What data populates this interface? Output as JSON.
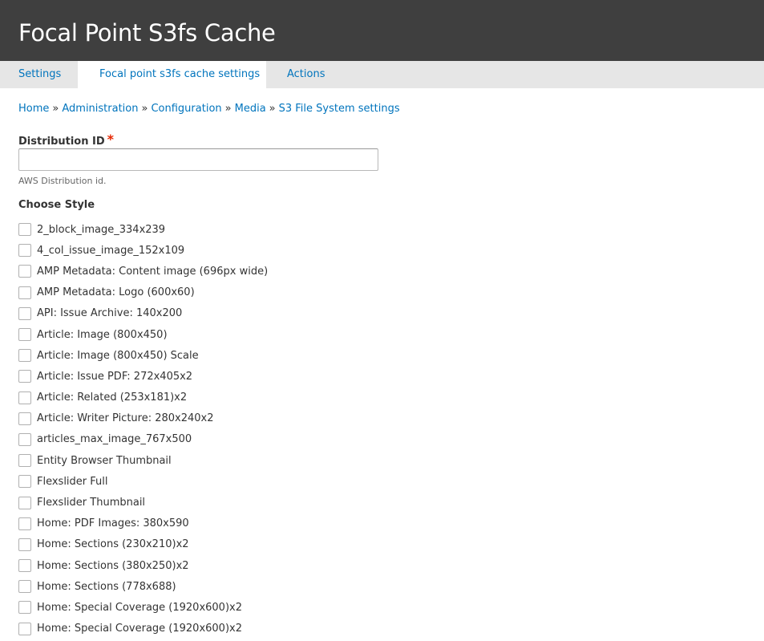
{
  "header": {
    "title": "Focal Point S3fs Cache"
  },
  "tabs": [
    {
      "label": "Settings"
    },
    {
      "label": "Focal point s3fs cache settings"
    },
    {
      "label": "Actions"
    }
  ],
  "breadcrumb": {
    "items": [
      "Home",
      "Administration",
      "Configuration",
      "Media",
      "S3 File System settings"
    ],
    "separator": "»"
  },
  "form": {
    "distribution_id": {
      "label": "Distribution ID",
      "required_mark": "*",
      "value": "",
      "description": "AWS Distribution id."
    },
    "choose_style": {
      "label": "Choose Style",
      "options": [
        "2_block_image_334x239",
        "4_col_issue_image_152x109",
        "AMP Metadata: Content image (696px wide)",
        "AMP Metadata: Logo (600x60)",
        "API: Issue Archive: 140x200",
        "Article: Image (800x450)",
        "Article: Image (800x450) Scale",
        "Article: Issue PDF: 272x405x2",
        "Article: Related (253x181)x2",
        "Article: Writer Picture: 280x240x2",
        "articles_max_image_767x500",
        "Entity Browser Thumbnail",
        "Flexslider Full",
        "Flexslider Thumbnail",
        "Home: PDF Images: 380x590",
        "Home: Sections (230x210)x2",
        "Home: Sections (380x250)x2",
        "Home: Sections (778x688)",
        "Home: Special Coverage (1920x600)x2",
        "Home: Special Coverage (1920x600)x2",
        ""
      ]
    }
  },
  "colors": {
    "header_bg": "#3f3f3f",
    "tabs_bg": "#e6e6e6",
    "link": "#0074bd",
    "required": "#e62600"
  }
}
